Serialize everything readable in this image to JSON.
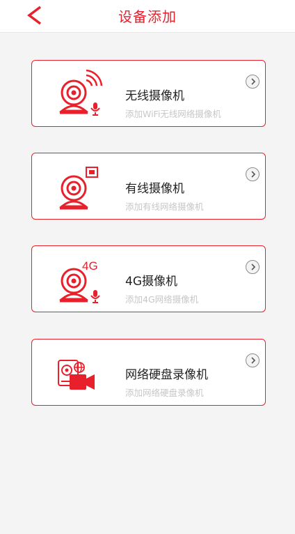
{
  "header": {
    "title": "设备添加",
    "back_icon": "chevron-left-icon"
  },
  "colors": {
    "accent": "#e8202b",
    "background": "#f4f4f4",
    "card_bg": "#ffffff",
    "desc_text": "#c7c7c7"
  },
  "devices": [
    {
      "name": "无线摄像机",
      "desc": "添加WiFi无线网络摄像机",
      "icon": "wifi-camera-icon"
    },
    {
      "name": "有线摄像机",
      "desc": "添加有线网络摄像机",
      "icon": "wired-camera-icon"
    },
    {
      "name": "4G摄像机",
      "desc": "添加4G网络摄像机",
      "icon": "4g-camera-icon",
      "badge": "4G"
    },
    {
      "name": "网络硬盘录像机",
      "desc": "添加网络硬盘录像机",
      "icon": "nvr-icon"
    }
  ]
}
